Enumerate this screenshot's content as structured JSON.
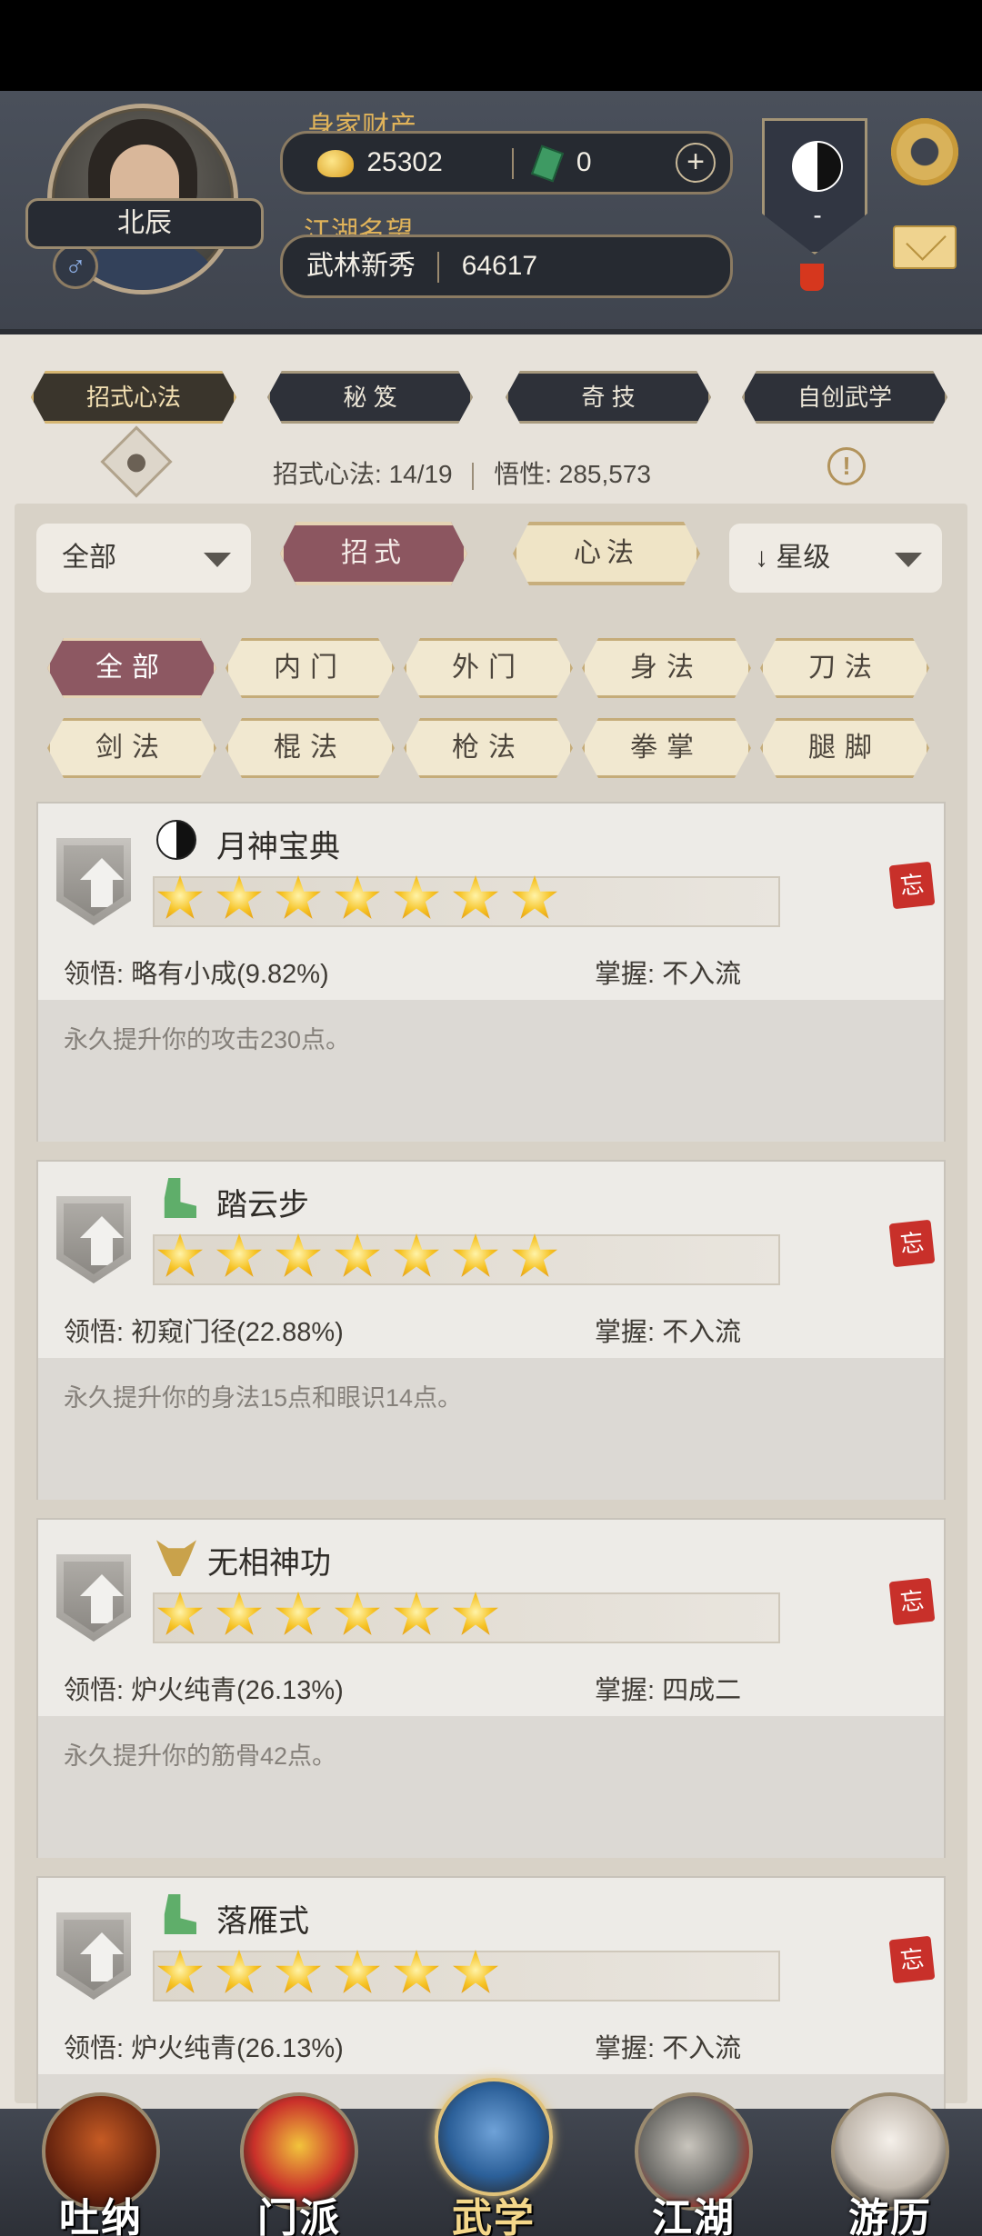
{
  "header": {
    "assets_label": "身家财产",
    "gold": "25302",
    "jade": "0",
    "plus": "+",
    "reputation_label": "江湖名望",
    "title": "武林新秀",
    "reputation_value": "64617",
    "player_name": "北辰",
    "gender": "♂",
    "sect_value": "-",
    "colors": {
      "gold_label": "#e0b35a",
      "bar_bg": "#262a31"
    }
  },
  "top_tabs": [
    "招式心法",
    "秘 笈",
    "奇 技",
    "自创武学"
  ],
  "stats": {
    "moves_label": "招式心法:",
    "moves_value": "14/19",
    "comprehension_label": "悟性:",
    "comprehension_value": "285,573",
    "info": "!"
  },
  "filters": {
    "scope": "全部",
    "seg_moves": "招式",
    "seg_mind": "心法",
    "sort": "↓ 星级"
  },
  "categories": [
    "全部",
    "内门",
    "外门",
    "身法",
    "刀法",
    "剑法",
    "棍法",
    "枪法",
    "拳掌",
    "腿脚"
  ],
  "skills": [
    {
      "name": "月神宝典",
      "icon": "taiji-icon",
      "stars": 7,
      "insight_label": "领悟:",
      "insight": "略有小成(9.82%)",
      "mastery_label": "掌握:",
      "mastery": "不入流",
      "desc": "永久提升你的攻击230点。",
      "seal": "忘"
    },
    {
      "name": "踏云步",
      "icon": "boot-icon",
      "stars": 7,
      "insight_label": "领悟:",
      "insight": "初窥门径(22.88%)",
      "mastery_label": "掌握:",
      "mastery": "不入流",
      "desc": "永久提升你的身法15点和眼识14点。",
      "seal": "忘"
    },
    {
      "name": "无相神功",
      "icon": "ox-icon",
      "stars": 6,
      "insight_label": "领悟:",
      "insight": "炉火纯青(26.13%)",
      "mastery_label": "掌握:",
      "mastery": "四成二",
      "desc": "永久提升你的筋骨42点。",
      "seal": "忘"
    },
    {
      "name": "落雁式",
      "icon": "boot-icon",
      "stars": 6,
      "insight_label": "领悟:",
      "insight": "炉火纯青(26.13%)",
      "mastery_label": "掌握:",
      "mastery": "不入流",
      "desc": "",
      "seal": "忘"
    }
  ],
  "bottom_nav": [
    "吐纳",
    "门派",
    "武学",
    "江湖",
    "游历"
  ],
  "active_nav": "武学"
}
